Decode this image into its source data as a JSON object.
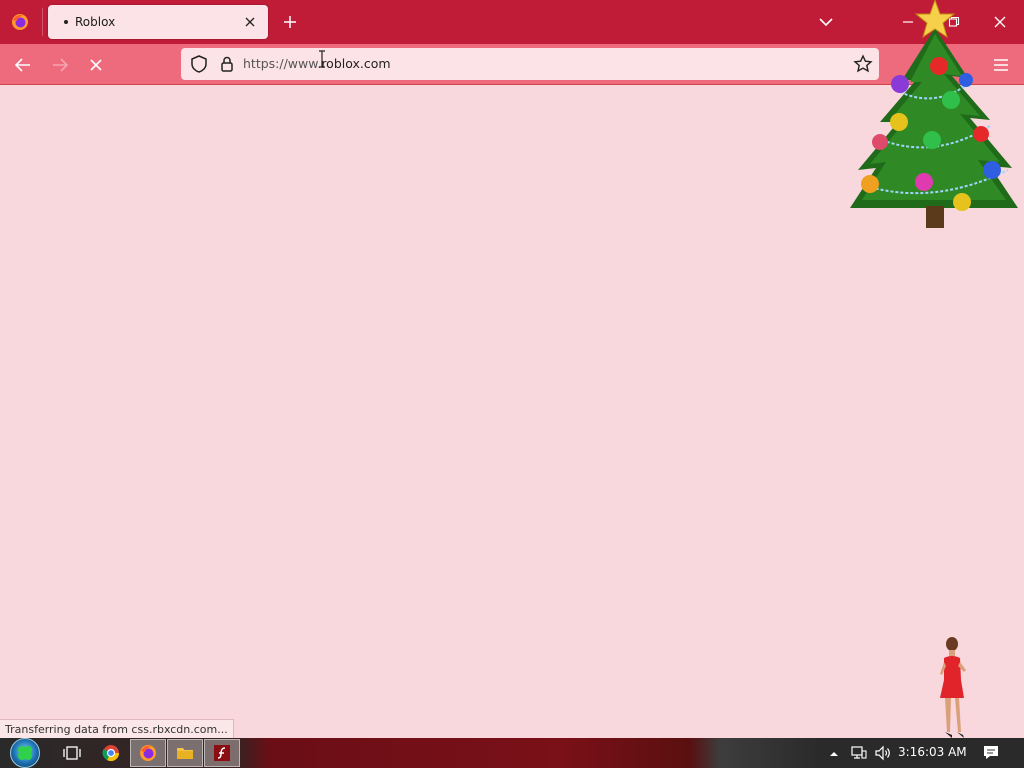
{
  "browser": {
    "tab": {
      "title": "Roblox"
    },
    "url": {
      "full": "https://www.roblox.com",
      "scheme_host_prefix": "https://www.",
      "domain": "roblox.com"
    },
    "icons": {
      "firefox_menu": "firefox-logo-icon",
      "tab_close": "close-icon",
      "new_tab": "plus-icon",
      "list_tabs": "chevron-down-icon",
      "minimize": "minimize-icon",
      "maximize": "maximize-icon",
      "window_close": "close-icon",
      "back": "arrow-left-icon",
      "forward": "arrow-right-icon",
      "stop": "stop-x-icon",
      "tracking_protection": "shield-icon",
      "security": "lock-icon",
      "bookmark": "star-icon",
      "app_menu": "hamburger-icon"
    },
    "status": "Transferring data from css.rbxcdn.com..."
  },
  "taskbar": {
    "clock": "3:16:03 AM",
    "apps": [
      "task-view",
      "chrome",
      "firefox",
      "file-explorer",
      "flash"
    ]
  },
  "colors": {
    "tabstrip": "#c01c38",
    "navbar": "#ee6b7e",
    "content_bg": "#f8d7dd",
    "tab_bg": "#fbe3e7"
  }
}
